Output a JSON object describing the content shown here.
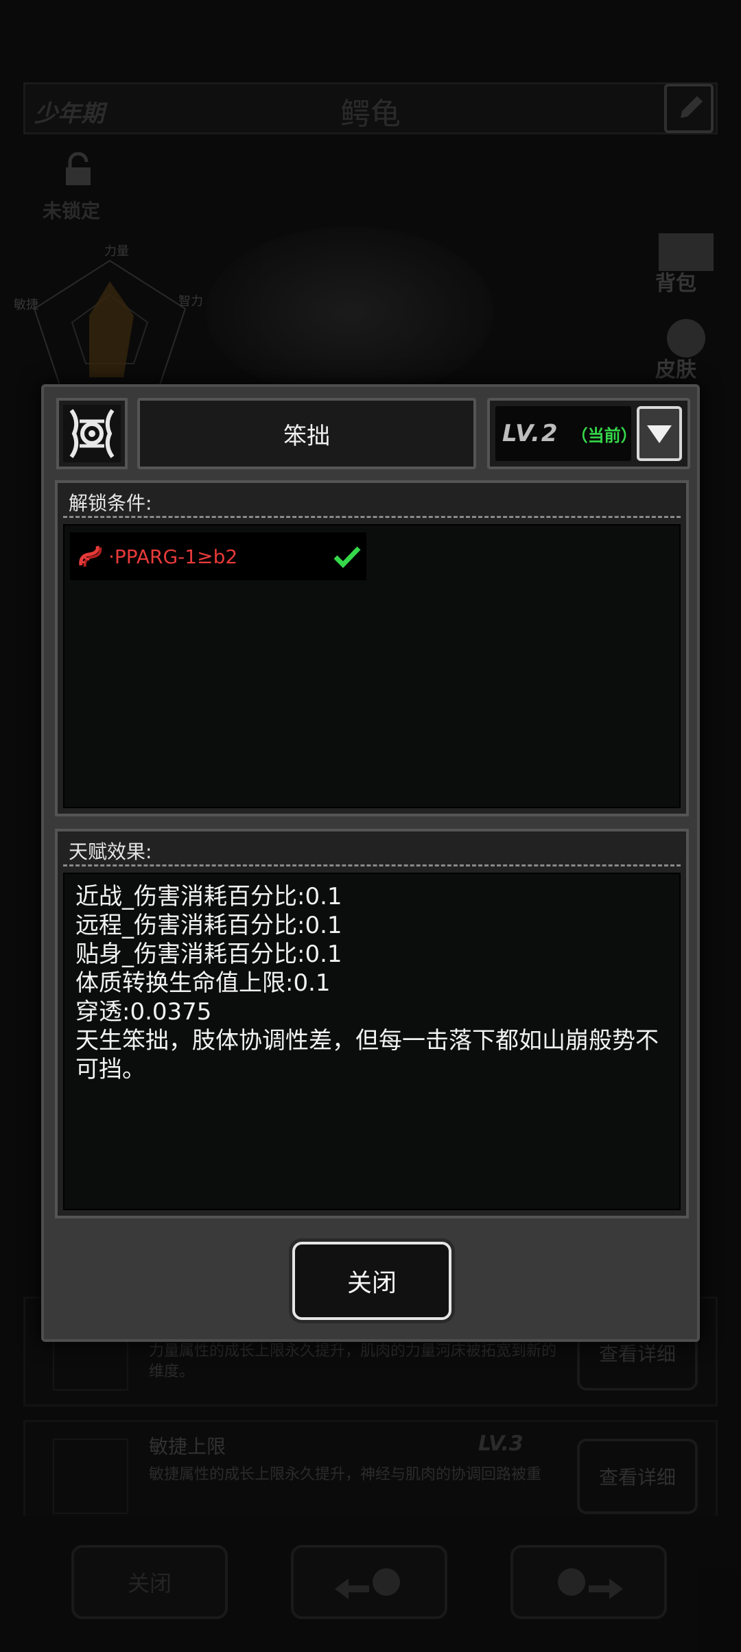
{
  "background": {
    "stage_label": "少年期",
    "creature_name": "鳄龟",
    "lock_label": "未锁定",
    "radar_labels": [
      "力量",
      "敏捷",
      "智力"
    ],
    "side_buttons": [
      {
        "label": "背包",
        "icon": "backpack-icon"
      },
      {
        "label": "皮肤",
        "icon": "skin-icon"
      }
    ],
    "rows": [
      {
        "title": "",
        "level": "",
        "description": "力量属性的成长上限永久提升，肌肉的力量河床被拓宽到新的维度。",
        "button": "查看详细"
      },
      {
        "title": "敏捷上限",
        "level": "LV.3",
        "description": "敏捷属性的成长上限永久提升，神经与肌肉的协调回路被重",
        "button": "查看详细"
      }
    ],
    "bottom_buttons": [
      {
        "label": "关闭"
      },
      {
        "label": "",
        "icon": "previous-creature-icon"
      },
      {
        "label": "",
        "icon": "next-creature-icon"
      }
    ]
  },
  "dialog": {
    "talent_icon": "talent-emblem-icon",
    "talent_name": "笨拙",
    "level": "LV.2",
    "level_status": "（当前）",
    "unlock": {
      "title": "解锁条件:",
      "conditions": [
        {
          "icon": "gene-icon",
          "text": "·PPARG-1≥b2",
          "met": true
        }
      ]
    },
    "effect": {
      "title": "天赋效果:",
      "text": "近战_伤害消耗百分比:0.1\n远程_伤害消耗百分比:0.1\n贴身_伤害消耗百分比:0.1\n体质转换生命值上限:0.1\n穿透:0.0375\n天生笨拙，肢体协调性差，但每一击落下都如山崩般势不可挡。"
    },
    "close_label": "关闭"
  },
  "colors": {
    "condition_red": "#e83a3a",
    "check_green": "#35d84a",
    "current_green": "#35d84a",
    "dialog_bg": "#3a3a3a",
    "radar_fill": "#8a5a14"
  }
}
